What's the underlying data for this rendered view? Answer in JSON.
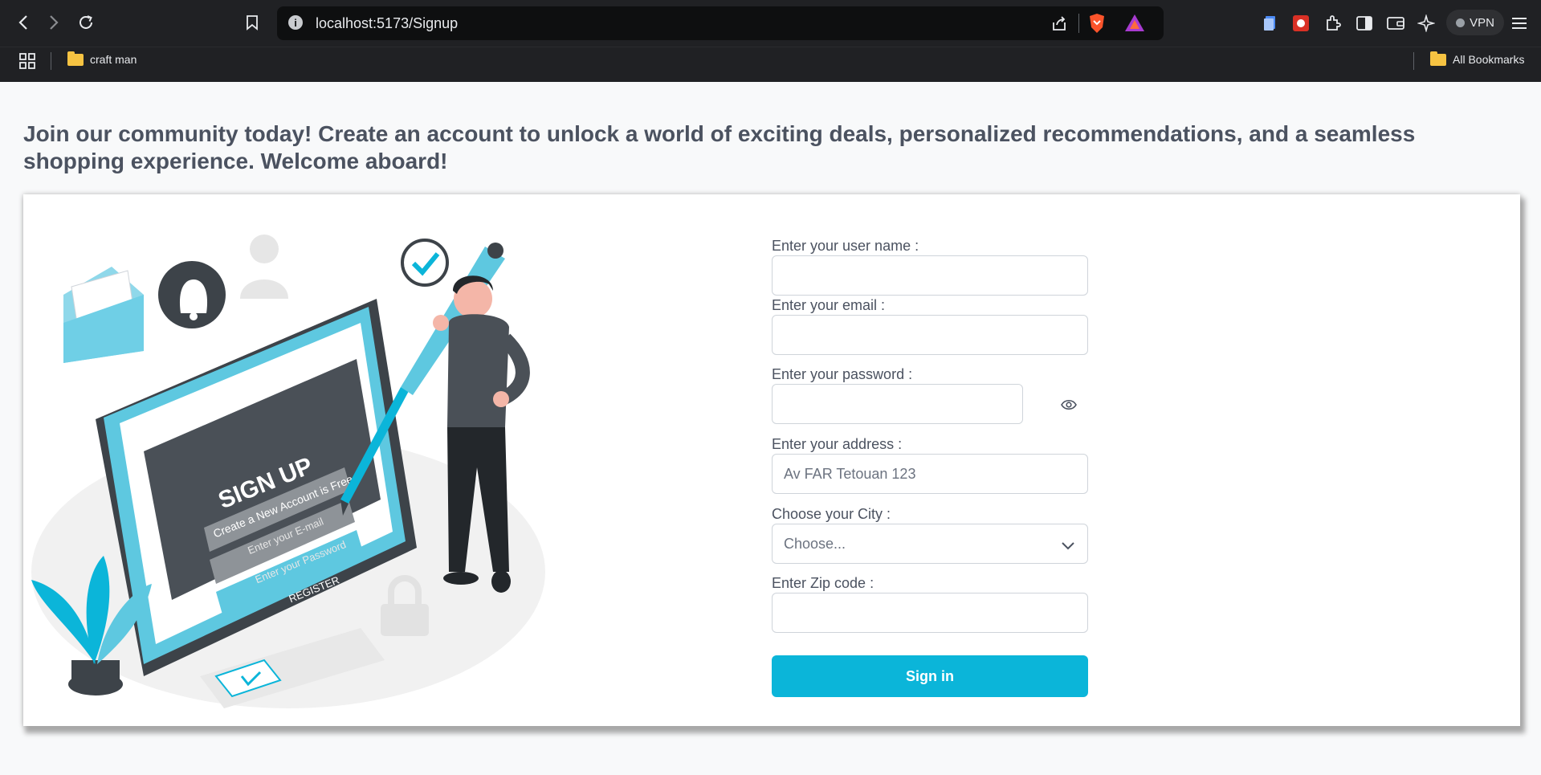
{
  "browser": {
    "url": "localhost:5173/Signup",
    "vpn_label": "VPN",
    "bookmarks": [
      "craft man"
    ],
    "all_bookmarks_label": "All Bookmarks"
  },
  "page": {
    "headline": "Join our community today! Create an account to unlock a world of exciting deals, personalized recommendations, and a seamless shopping experience. Welcome aboard!"
  },
  "illustration": {
    "title": "SIGN UP",
    "subtitle": "Create a New Account is Free",
    "email_field": "Enter your E-mail",
    "password_field": "Enter your Password",
    "register": "REGISTER"
  },
  "form": {
    "username_label": "Enter your user name :",
    "username_value": "",
    "email_label": "Enter your email :",
    "email_value": "",
    "password_label": "Enter your password :",
    "password_value": "",
    "address_label": "Enter your address :",
    "address_placeholder": "Av FAR Tetouan 123",
    "city_label": "Choose your City :",
    "city_selected": "Choose...",
    "zip_label": "Enter Zip code :",
    "zip_value": "",
    "submit_label": "Sign in"
  },
  "colors": {
    "accent": "#0bb5d9",
    "chrome": "#202124",
    "text": "#4b5260"
  }
}
